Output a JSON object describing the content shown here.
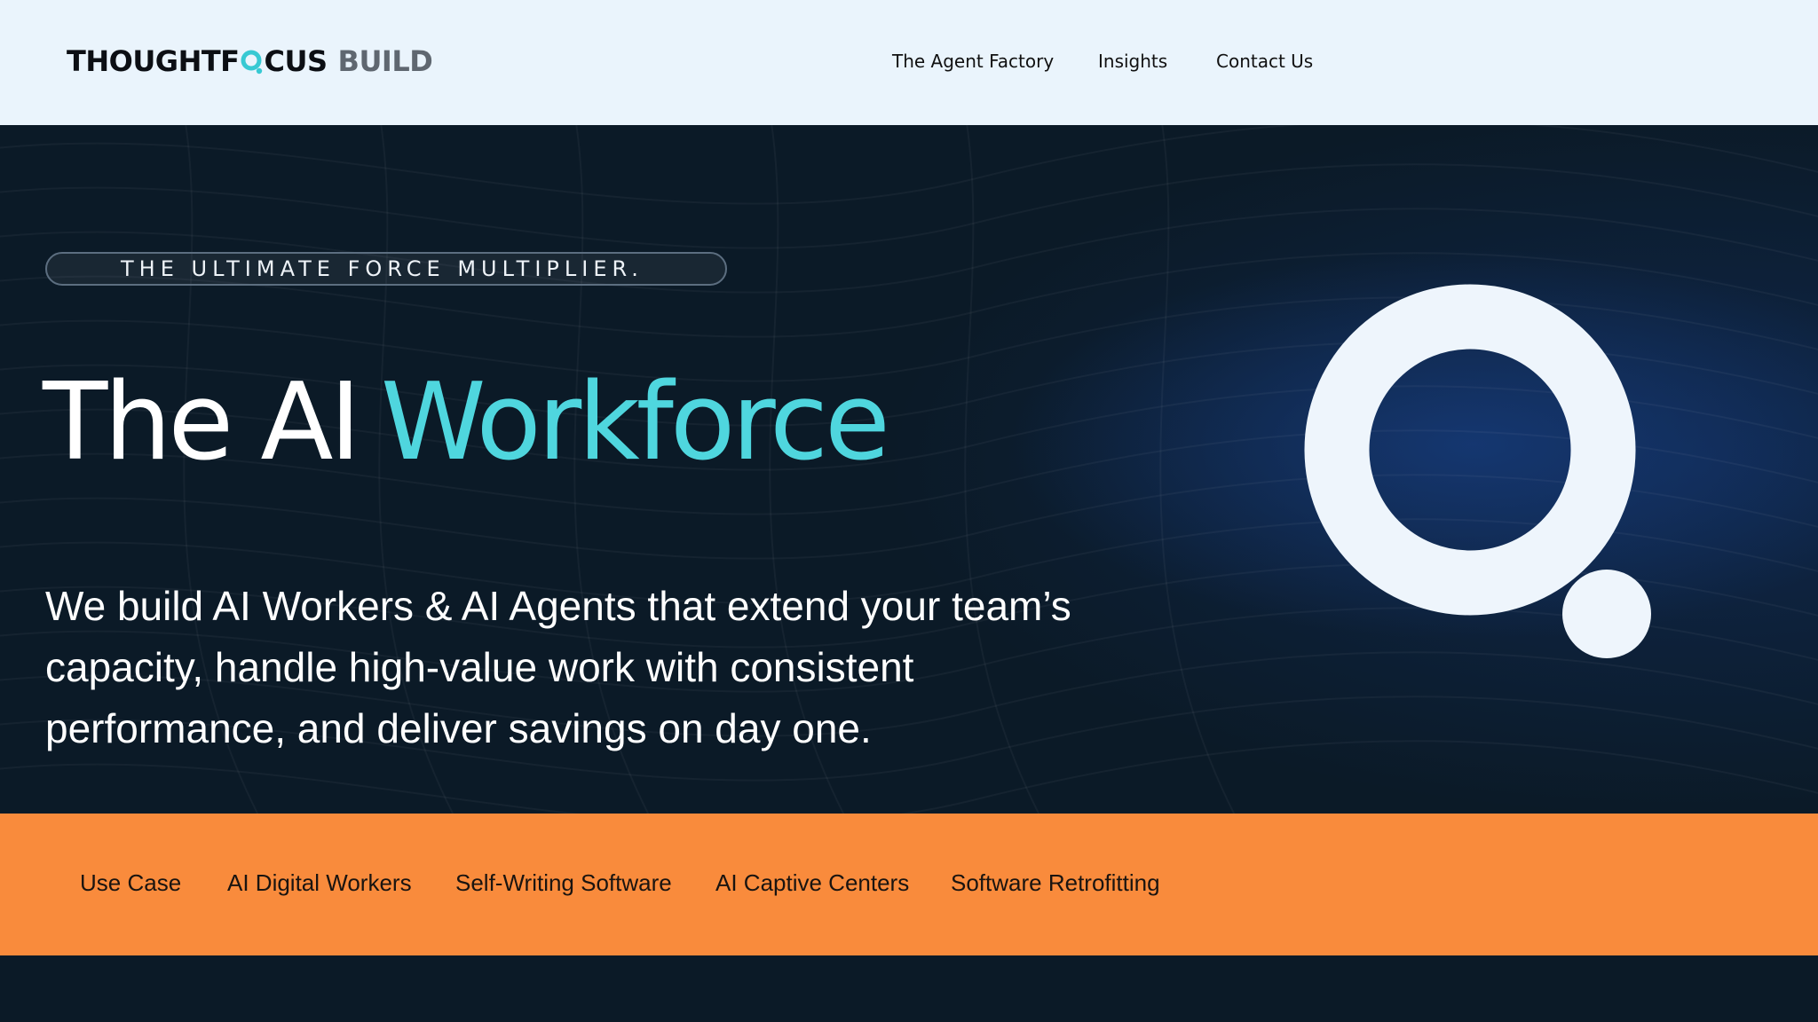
{
  "header": {
    "logo": {
      "part1": "THOUGHTF",
      "part2": "CUS",
      "part3": "BUILD"
    },
    "nav": [
      {
        "label": "The Agent Factory"
      },
      {
        "label": "Insights"
      },
      {
        "label": "Contact Us"
      }
    ]
  },
  "hero": {
    "eyebrow": "THE ULTIMATE FORCE MULTIPLIER.",
    "headline_white": "The AI",
    "headline_accent": "Workforce",
    "subtext": "We build AI Workers & AI Agents that extend your team’s capacity, handle high-value work with consistent performance, and deliver savings on day one."
  },
  "tabs": [
    {
      "label": "Use Case"
    },
    {
      "label": "AI Digital Workers"
    },
    {
      "label": "Self-Writing Software"
    },
    {
      "label": "AI Captive Centers"
    },
    {
      "label": "Software Retrofitting"
    }
  ],
  "colors": {
    "header_bg": "#eaf4fc",
    "hero_bg": "#0b1a27",
    "accent_cyan": "#4fd6de",
    "tab_bar_orange": "#f98b3c",
    "mark_white": "#eef5fc"
  },
  "icons": {
    "logo_o": "q-logo-icon",
    "hero_mark": "q-brand-mark-icon"
  }
}
